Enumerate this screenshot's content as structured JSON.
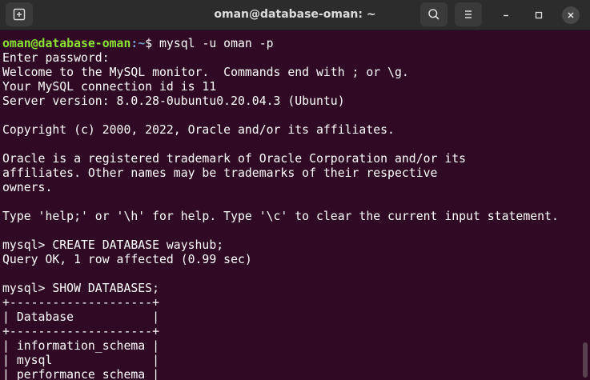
{
  "titlebar": {
    "title": "oman@database-oman: ~",
    "new_tab_icon": "new-tab-icon",
    "search_icon": "search-icon",
    "menu_icon": "hamburger-menu-icon",
    "minimize_icon": "minimize-icon",
    "maximize_icon": "maximize-icon",
    "close_icon": "close-icon"
  },
  "terminal": {
    "prompt_user": "oman@database-oman",
    "prompt_path": ":~",
    "prompt_command": "$ mysql -u oman -p",
    "output": [
      "Enter password:",
      "Welcome to the MySQL monitor.  Commands end with ; or \\g.",
      "Your MySQL connection id is 11",
      "Server version: 8.0.28-0ubuntu0.20.04.3 (Ubuntu)",
      "",
      "Copyright (c) 2000, 2022, Oracle and/or its affiliates.",
      "",
      "Oracle is a registered trademark of Oracle Corporation and/or its",
      "affiliates. Other names may be trademarks of their respective",
      "owners.",
      "",
      "Type 'help;' or '\\h' for help. Type '\\c' to clear the current input statement.",
      "",
      "mysql> CREATE DATABASE wayshub;",
      "Query OK, 1 row affected (0.99 sec)",
      "",
      "mysql> SHOW DATABASES;",
      "+--------------------+",
      "| Database           |",
      "+--------------------+",
      "| information_schema |",
      "| mysql              |",
      "| performance_schema |"
    ]
  },
  "colors": {
    "background": "#300a24",
    "titlebar": "#2c2c2c",
    "prompt_user": "#8ae234",
    "prompt_path": "#729fcf",
    "text": "#ffffff"
  }
}
